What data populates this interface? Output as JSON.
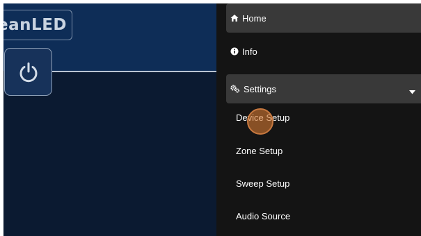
{
  "brand": {
    "logo_text": "ceanLED"
  },
  "power": {
    "icon": "power-icon"
  },
  "menu": {
    "home_label": "Home",
    "info_label": "Info",
    "settings_label": "Settings",
    "settings_expanded": true,
    "submenu": [
      "Device Setup",
      "Zone Setup",
      "Sweep Setup",
      "Audio Source"
    ]
  },
  "colors": {
    "left_bg": "#0b1a31",
    "header_bg": "#0e2d57",
    "menu_bg": "#141414",
    "item_bg": "#393939",
    "click_marker": "#d67830"
  }
}
